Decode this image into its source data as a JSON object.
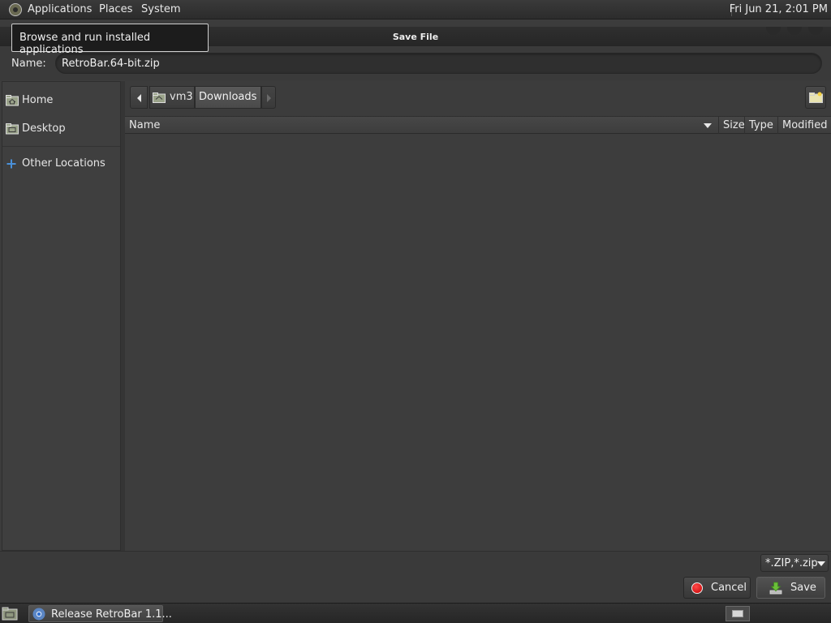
{
  "top_panel": {
    "menus": [
      "Applications",
      "Places",
      "System"
    ],
    "clock": "Fri Jun 21,  2:01 PM"
  },
  "tooltip": {
    "text": "Browse and run installed applications"
  },
  "window": {
    "title": "Save File"
  },
  "name_row": {
    "label": "Name:",
    "value": "RetroBar.64-bit.zip"
  },
  "sidebar": {
    "items": [
      {
        "label": "Home",
        "icon": "folder-home-icon"
      },
      {
        "label": "Desktop",
        "icon": "folder-desktop-icon"
      },
      {
        "label": "Other Locations",
        "icon": "plus-icon"
      }
    ]
  },
  "pathbar": {
    "segments": [
      "vm3",
      "Downloads"
    ]
  },
  "file_list": {
    "columns": [
      "Name",
      "Size",
      "Type",
      "Modified"
    ],
    "rows": []
  },
  "filter": {
    "selected": "*.ZIP,*.zip"
  },
  "buttons": {
    "cancel": "Cancel",
    "save": "Save"
  },
  "taskbar": {
    "tasks": [
      "Release RetroBar 1.1..."
    ]
  },
  "colors": {
    "accent": "#4a90d9",
    "cancel_red": "#d40000",
    "save_green": "#6bbf3a"
  }
}
